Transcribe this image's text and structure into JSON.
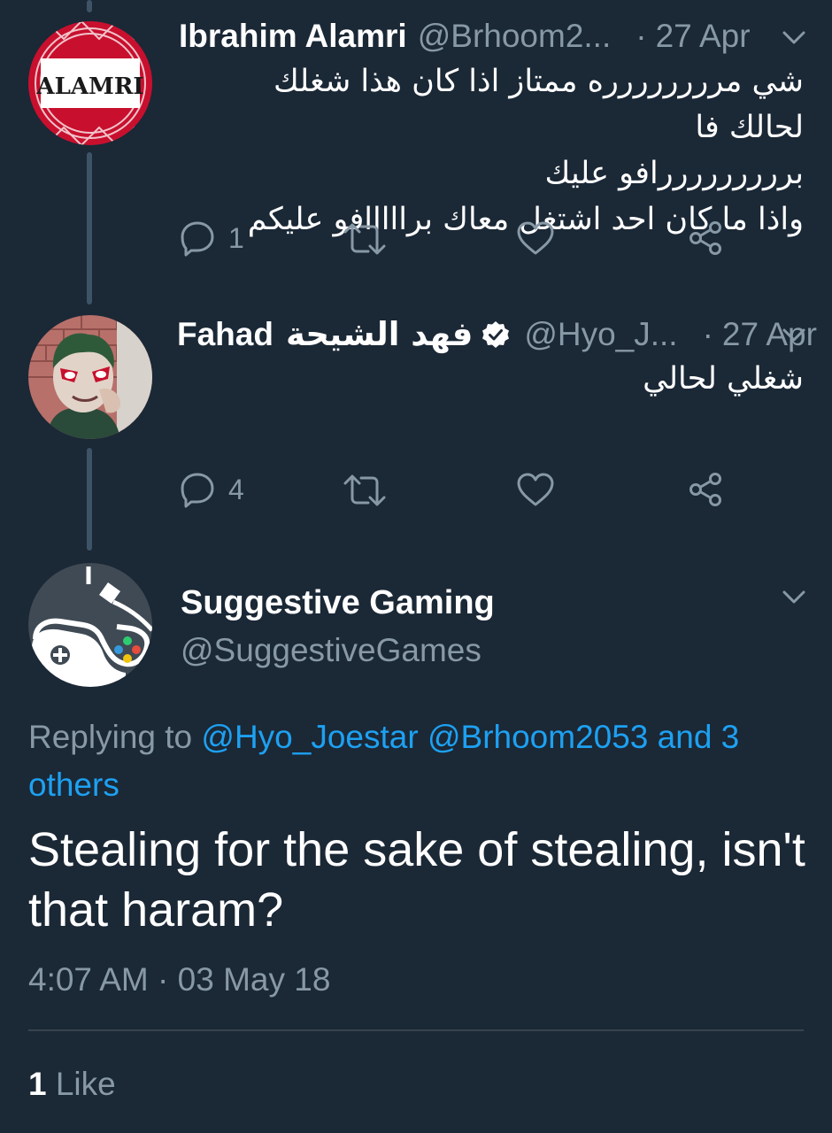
{
  "tweet1": {
    "name": "Ibrahim Alamri",
    "handle": "@Brhoom2...",
    "dot": "·",
    "date": "27 Apr",
    "lines": [
      "شي مرررررررره ممتاز اذا كان هذا شغلك لحالك فا",
      "برررررررررافو عليك",
      "واذا ما كان احد اشتغل معاك برااااافو عليكم"
    ],
    "reply_count": "1",
    "avatar_text": "ALAMRI"
  },
  "tweet2": {
    "name": "Fahad",
    "name_ar": "فهد الشيحة",
    "handle": "@Hyo_J...",
    "dot": "·",
    "date": "27 Apr",
    "text": "شغلي لحالي",
    "reply_count": "4"
  },
  "main": {
    "name": "Suggestive Gaming",
    "handle": "@SuggestiveGames",
    "replying_prefix": "Replying to",
    "mention1": "@Hyo_Joestar",
    "mention2": "@Brhoom2053",
    "others": "and 3 others",
    "text": "Stealing for the sake of stealing, isn't that haram?",
    "timestamp": "4:07 AM · 03 May 18",
    "likes_count": "1",
    "likes_label": "Like"
  },
  "colors": {
    "background": "#1b2836",
    "secondary_text": "#8899a6",
    "link": "#1da1f2",
    "verified": "#ffffff"
  },
  "icons": [
    "reply-icon",
    "retweet-icon",
    "like-icon",
    "share-icon",
    "chevron-down-icon",
    "verified-badge-icon"
  ]
}
